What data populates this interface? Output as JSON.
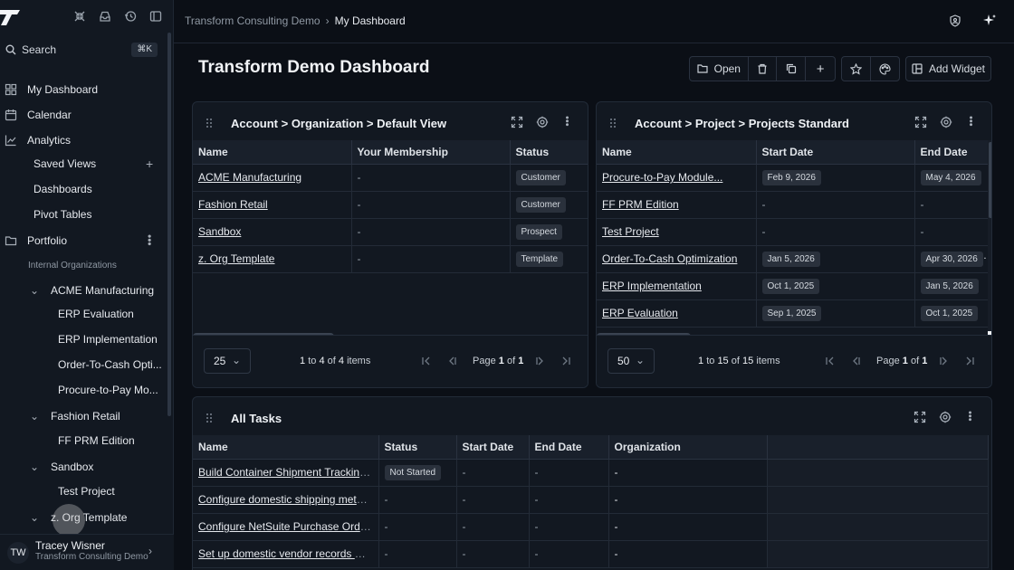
{
  "sidebar": {
    "search_label": "Search",
    "search_shortcut": "⌘K",
    "items": {
      "my_dashboard": "My Dashboard",
      "calendar": "Calendar",
      "analytics": "Analytics",
      "saved_views": "Saved Views",
      "dashboards": "Dashboards",
      "pivot_tables": "Pivot Tables",
      "portfolio": "Portfolio",
      "internal_orgs": "Internal Organizations",
      "acme": "ACME Manufacturing",
      "erp_eval": "ERP Evaluation",
      "erp_impl": "ERP Implementation",
      "otc": "Order-To-Cash Opti...",
      "ptp": "Procure-to-Pay Mo...",
      "fashion": "Fashion Retail",
      "ffprm": "FF PRM Edition",
      "sandbox": "Sandbox",
      "test_project": "Test Project",
      "zorg": "z. Org Template"
    },
    "user": {
      "initials": "TW",
      "name": "Tracey Wisner",
      "org": "Transform Consulting Demo"
    }
  },
  "header": {
    "breadcrumb_root": "Transform Consulting Demo",
    "breadcrumb_current": "My Dashboard"
  },
  "page": {
    "title": "Transform Demo Dashboard",
    "open_label": "Open",
    "add_widget_label": "Add Widget"
  },
  "widget_orgs": {
    "title": "Account > Organization > Default View",
    "columns": [
      "Name",
      "Your Membership",
      "Status"
    ],
    "rows": [
      {
        "name": "ACME Manufacturing",
        "membership": "-",
        "status": "Customer"
      },
      {
        "name": "Fashion Retail",
        "membership": "-",
        "status": "Customer"
      },
      {
        "name": "Sandbox",
        "membership": "-",
        "status": "Prospect"
      },
      {
        "name": "z. Org Template",
        "membership": "-",
        "status": "Template"
      }
    ],
    "page_size": "25",
    "range_start": "1",
    "range_end": "4",
    "total": "4",
    "page_label": "Page",
    "page": "1",
    "pages": "1"
  },
  "widget_projects": {
    "title": "Account > Project > Projects Standard",
    "columns": [
      "Name",
      "Start Date",
      "End Date"
    ],
    "rows": [
      {
        "name": "Procure-to-Pay Module...",
        "start": "Feb 9, 2026",
        "end": "May 4, 2026"
      },
      {
        "name": "FF PRM Edition",
        "start": "-",
        "end": "-"
      },
      {
        "name": "Test Project",
        "start": "-",
        "end": "-"
      },
      {
        "name": "Order-To-Cash Optimization",
        "start": "Jan 5, 2026",
        "end": "Apr 30, 2026"
      },
      {
        "name": "ERP Implementation",
        "start": "Oct 1, 2025",
        "end": "Jan 5, 2026"
      },
      {
        "name": "ERP Evaluation",
        "start": "Sep 1, 2025",
        "end": "Oct 1, 2025"
      }
    ],
    "page_size": "50",
    "range_start": "1",
    "range_end": "15",
    "total": "15",
    "page_label": "Page",
    "page": "1",
    "pages": "1"
  },
  "widget_tasks": {
    "title": "All Tasks",
    "columns": [
      "Name",
      "Status",
      "Start Date",
      "End Date",
      "Organization"
    ],
    "rows": [
      {
        "name": "Build Container Shipment Tracking...",
        "status": "Not Started",
        "start": "-",
        "end": "-",
        "org": "-"
      },
      {
        "name": "Configure domestic shipping methods...",
        "status": "-",
        "start": "-",
        "end": "-",
        "org": "-"
      },
      {
        "name": "Configure NetSuite Purchase Order (P...",
        "status": "-",
        "start": "-",
        "end": "-",
        "org": "-"
      },
      {
        "name": "Set up domestic vendor records with...",
        "status": "-",
        "start": "-",
        "end": "-",
        "org": "-"
      }
    ]
  },
  "labels": {
    "to": "to",
    "of": "of",
    "items": "items"
  }
}
